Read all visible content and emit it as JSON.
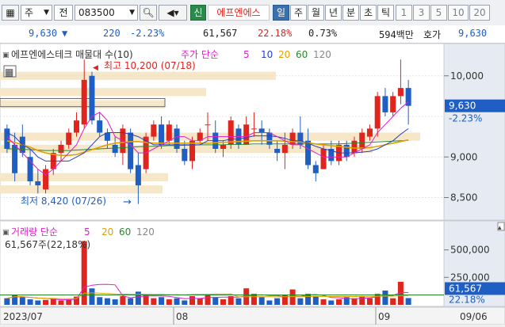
{
  "toolbar": {
    "icon_label": "▦",
    "main_select": "주",
    "jeon_select": "전",
    "code": "083500",
    "company_badge": "신",
    "company_name": "에프엔에스",
    "periods": [
      "일",
      "주",
      "월",
      "년",
      "분",
      "초",
      "틱"
    ],
    "active_period": "일",
    "intervals": [
      "1",
      "3",
      "5",
      "10",
      "20"
    ]
  },
  "quote": {
    "price": "9,630",
    "direction_arrow": "▼",
    "change": "220",
    "change_pct": "-2.23%",
    "volume": "61,567",
    "volume_ratio": "22.18%",
    "turnover": "0.73%",
    "trade_value": "594백만",
    "hoga_label": "호가",
    "hoga_value": "9,630"
  },
  "price_panel": {
    "legend_name": "에프엔에스테크 매물대 수(10)",
    "legend_ma_title": "주가 단순",
    "legend_periods": [
      "5",
      "10",
      "20",
      "60",
      "120"
    ],
    "high_annotation": "최고 10,200 (07/18)",
    "low_annotation": "최저 8,420 (07/26)",
    "y_ticks": [
      "10,000",
      "9,000",
      "8,500"
    ],
    "current_price_label": "9,630",
    "current_pct_label": "-2.23%"
  },
  "volume_panel": {
    "legend_title": "거래량 단순",
    "legend_periods": [
      "5",
      "20",
      "60",
      "120"
    ],
    "current_volume_text": "61,567주(22,18%)",
    "y_ticks": [
      "500,000",
      "250,000"
    ],
    "current_volume_label": "61,567",
    "current_pct_label": "22.18%"
  },
  "x_axis": {
    "labels": [
      "2023/07",
      "08",
      "09",
      "09/06"
    ]
  },
  "colors": {
    "up": "#e0241e",
    "down": "#1f5fc4",
    "ma5": "#e020c8",
    "ma10": "#2a3fc4",
    "ma20": "#e0a000",
    "ma60": "#2a8a2a",
    "ma120": "#888888",
    "profile": "#f6e7c8",
    "accent": "#1f5fc4"
  },
  "chart_data": {
    "type": "candlestick",
    "ohlc": [
      {
        "o": 9350,
        "h": 9400,
        "l": 9050,
        "c": 9100
      },
      {
        "o": 9150,
        "h": 9300,
        "l": 8700,
        "c": 8800
      },
      {
        "o": 9250,
        "h": 9400,
        "l": 9000,
        "c": 9050
      },
      {
        "o": 9000,
        "h": 9100,
        "l": 8650,
        "c": 8700
      },
      {
        "o": 8700,
        "h": 8850,
        "l": 8550,
        "c": 8650
      },
      {
        "o": 8600,
        "h": 8900,
        "l": 8550,
        "c": 8850
      },
      {
        "o": 8850,
        "h": 9100,
        "l": 8780,
        "c": 9050
      },
      {
        "o": 9050,
        "h": 9200,
        "l": 8950,
        "c": 9150
      },
      {
        "o": 9150,
        "h": 9350,
        "l": 9100,
        "c": 9300
      },
      {
        "o": 9300,
        "h": 9550,
        "l": 9250,
        "c": 9450
      },
      {
        "o": 9400,
        "h": 10200,
        "l": 9350,
        "c": 9950
      },
      {
        "o": 10000,
        "h": 10050,
        "l": 9400,
        "c": 9450
      },
      {
        "o": 9450,
        "h": 9550,
        "l": 9250,
        "c": 9300
      },
      {
        "o": 9300,
        "h": 9350,
        "l": 9100,
        "c": 9200
      },
      {
        "o": 9150,
        "h": 9250,
        "l": 9000,
        "c": 9050
      },
      {
        "o": 9050,
        "h": 9400,
        "l": 8900,
        "c": 9350
      },
      {
        "o": 9300,
        "h": 9350,
        "l": 8800,
        "c": 8850
      },
      {
        "o": 8900,
        "h": 9050,
        "l": 8420,
        "c": 8650
      },
      {
        "o": 8850,
        "h": 9300,
        "l": 8800,
        "c": 9250
      },
      {
        "o": 9250,
        "h": 9450,
        "l": 9200,
        "c": 9400
      },
      {
        "o": 9400,
        "h": 9500,
        "l": 9100,
        "c": 9150
      },
      {
        "o": 9200,
        "h": 9450,
        "l": 9150,
        "c": 9400
      },
      {
        "o": 9350,
        "h": 9400,
        "l": 9050,
        "c": 9100
      },
      {
        "o": 9100,
        "h": 9200,
        "l": 8900,
        "c": 8950
      },
      {
        "o": 8950,
        "h": 9250,
        "l": 8850,
        "c": 9200
      },
      {
        "o": 9200,
        "h": 9350,
        "l": 9150,
        "c": 9300
      },
      {
        "o": 9400,
        "h": 9550,
        "l": 9200,
        "c": 9400
      },
      {
        "o": 9300,
        "h": 9450,
        "l": 9050,
        "c": 9100
      },
      {
        "o": 9100,
        "h": 9200,
        "l": 9000,
        "c": 9150
      },
      {
        "o": 9150,
        "h": 9500,
        "l": 9100,
        "c": 9450
      },
      {
        "o": 9350,
        "h": 9400,
        "l": 9100,
        "c": 9150
      },
      {
        "o": 9150,
        "h": 9500,
        "l": 9150,
        "c": 9400
      },
      {
        "o": 9350,
        "h": 9550,
        "l": 9250,
        "c": 9350
      },
      {
        "o": 9350,
        "h": 9450,
        "l": 9150,
        "c": 9300
      },
      {
        "o": 9300,
        "h": 9350,
        "l": 9100,
        "c": 9150
      },
      {
        "o": 9100,
        "h": 9200,
        "l": 8950,
        "c": 9050
      },
      {
        "o": 9050,
        "h": 9300,
        "l": 8850,
        "c": 9150
      },
      {
        "o": 9150,
        "h": 9350,
        "l": 9100,
        "c": 9300
      },
      {
        "o": 9300,
        "h": 9500,
        "l": 9100,
        "c": 9150
      },
      {
        "o": 9200,
        "h": 9350,
        "l": 8850,
        "c": 8900
      },
      {
        "o": 8900,
        "h": 8950,
        "l": 8700,
        "c": 8800
      },
      {
        "o": 8850,
        "h": 9150,
        "l": 8850,
        "c": 9100
      },
      {
        "o": 9100,
        "h": 9200,
        "l": 8900,
        "c": 8950
      },
      {
        "o": 8950,
        "h": 9200,
        "l": 8900,
        "c": 9150
      },
      {
        "o": 9150,
        "h": 9200,
        "l": 8950,
        "c": 9000
      },
      {
        "o": 9050,
        "h": 9250,
        "l": 9000,
        "c": 9200
      },
      {
        "o": 9100,
        "h": 9350,
        "l": 9050,
        "c": 9300
      },
      {
        "o": 9250,
        "h": 9400,
        "l": 9200,
        "c": 9350
      },
      {
        "o": 9350,
        "h": 9800,
        "l": 9250,
        "c": 9750
      },
      {
        "o": 9750,
        "h": 9850,
        "l": 9500,
        "c": 9550
      },
      {
        "o": 9550,
        "h": 9800,
        "l": 9500,
        "c": 9750
      },
      {
        "o": 9750,
        "h": 10200,
        "l": 9650,
        "c": 9850
      },
      {
        "o": 9850,
        "h": 9950,
        "l": 9400,
        "c": 9630
      }
    ],
    "volume": [
      60000,
      90000,
      70000,
      50000,
      40000,
      45000,
      55000,
      40000,
      50000,
      75000,
      580000,
      150000,
      70000,
      60000,
      50000,
      80000,
      60000,
      120000,
      90000,
      60000,
      70000,
      50000,
      60000,
      40000,
      80000,
      60000,
      90000,
      70000,
      50000,
      80000,
      60000,
      150000,
      100000,
      70000,
      40000,
      60000,
      90000,
      140000,
      60000,
      100000,
      80000,
      50000,
      40000,
      50000,
      70000,
      60000,
      80000,
      60000,
      100000,
      130000,
      60000,
      210000,
      61567
    ],
    "ma5": [
      9250,
      9150,
      9050,
      8950,
      8850,
      8780,
      8850,
      8950,
      9050,
      9150,
      9350,
      9500,
      9550,
      9450,
      9250,
      9200,
      9150,
      9050,
      9050,
      9100,
      9150,
      9200,
      9250,
      9250,
      9200,
      9200,
      9250,
      9250,
      9250,
      9250,
      9250,
      9250,
      9300,
      9300,
      9300,
      9250,
      9200,
      9150,
      9150,
      9100,
      9050,
      9000,
      9000,
      9000,
      9000,
      9050,
      9100,
      9150,
      9300,
      9400,
      9500,
      9600,
      9680
    ],
    "ma10": [
      9300,
      9250,
      9150,
      9100,
      9000,
      8950,
      8950,
      8950,
      8950,
      9000,
      9050,
      9150,
      9250,
      9300,
      9300,
      9300,
      9280,
      9250,
      9200,
      9150,
      9150,
      9150,
      9150,
      9150,
      9150,
      9150,
      9200,
      9200,
      9200,
      9220,
      9220,
      9240,
      9260,
      9260,
      9260,
      9250,
      9230,
      9200,
      9200,
      9170,
      9130,
      9100,
      9080,
      9050,
      9050,
      9050,
      9060,
      9070,
      9100,
      9150,
      9200,
      9280,
      9350
    ],
    "ma20": [
      9200,
      9180,
      9150,
      9120,
      9080,
      9050,
      9030,
      9020,
      9020,
      9030,
      9060,
      9090,
      9120,
      9150,
      9170,
      9180,
      9190,
      9190,
      9180,
      9170,
      9170,
      9170,
      9170,
      9170,
      9170,
      9170,
      9170,
      9175,
      9180,
      9185,
      9190,
      9195,
      9200,
      9200,
      9200,
      9200,
      9195,
      9190,
      9185,
      9175,
      9160,
      9150,
      9140,
      9130,
      9120,
      9110,
      9110,
      9115,
      9130,
      9150,
      9170,
      9190,
      9210
    ],
    "ma60": [
      9100,
      9100,
      9095,
      9090,
      9085,
      9080,
      9080,
      9080,
      9080,
      9085,
      9090,
      9095,
      9100,
      9105,
      9110,
      9115,
      9120,
      9125,
      9130,
      9130,
      9135,
      9140,
      9140,
      9145,
      9145,
      9150,
      9150,
      9150,
      9150,
      9155,
      9155,
      9155,
      9160,
      9160,
      9160,
      9160,
      9160,
      9160,
      9160,
      9160,
      9160,
      9160,
      9160,
      9160,
      9165,
      9170,
      9175,
      9180,
      9185,
      9190,
      9195,
      9200,
      9205
    ]
  }
}
